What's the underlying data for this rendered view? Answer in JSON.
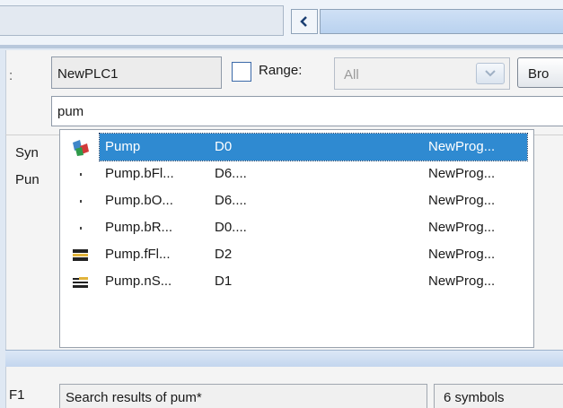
{
  "toolbar": {
    "plc_name": "NewPLC1",
    "range_label": "Range:",
    "range_checked": false,
    "range_value": "All",
    "browse_label": "Bro"
  },
  "search": {
    "value": "pum"
  },
  "left_panel": {
    "colon": ":",
    "header": "Syn",
    "cell": "Pun"
  },
  "results": [
    {
      "icon": "function-block-icon",
      "name": "Pump",
      "address": "D0",
      "scope": "NewProg...",
      "selected": true
    },
    {
      "icon": "bool-dot-icon",
      "name": "Pump.bFl...",
      "address": "D6....",
      "scope": "NewProg...",
      "selected": false
    },
    {
      "icon": "bool-dot-icon",
      "name": "Pump.bO...",
      "address": "D6....",
      "scope": "NewProg...",
      "selected": false
    },
    {
      "icon": "bool-dot-icon",
      "name": "Pump.bR...",
      "address": "D0....",
      "scope": "NewProg...",
      "selected": false
    },
    {
      "icon": "real-var-icon",
      "name": "Pump.fFl...",
      "address": "D2",
      "scope": "NewProg...",
      "selected": false
    },
    {
      "icon": "int-var-icon",
      "name": "Pump.nS...",
      "address": "D1",
      "scope": "NewProg...",
      "selected": false
    }
  ],
  "status": {
    "key": "F1",
    "message": "Search results of pum*",
    "count": "6 symbols"
  },
  "colors": {
    "selection": "#2f8ad1",
    "checkbox_border": "#3b69a8"
  }
}
